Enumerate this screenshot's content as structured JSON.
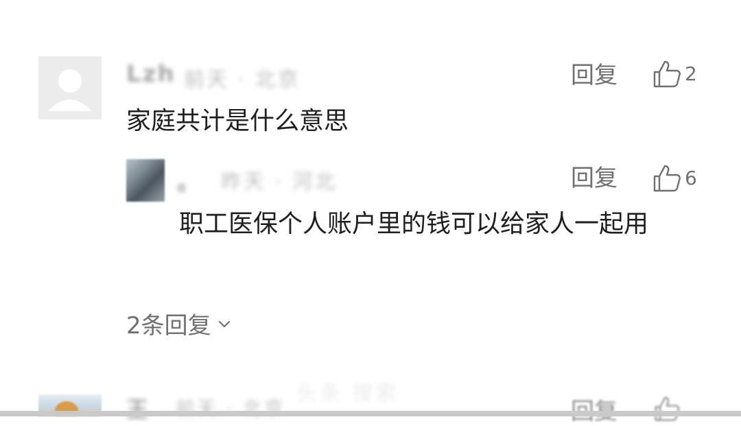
{
  "comments": [
    {
      "username": "Lzh",
      "meta": "前天 · 北京",
      "text": "家庭共计是什么意思",
      "reply_label": "回复",
      "likes": "2",
      "avatar_icon": "default-user-avatar-icon",
      "replies": [
        {
          "username": "。",
          "meta": "昨天 · 河北",
          "text": "职工医保个人账户里的钱可以给家人一起用",
          "reply_label": "回复",
          "likes": "6"
        }
      ],
      "more_replies_label": "2条回复"
    },
    {
      "username": "王",
      "meta": "前天 · 北京",
      "reply_label": "回复"
    }
  ],
  "watermark_text": "头条 搜索",
  "colors": {
    "text_primary": "#1e1e1e",
    "text_secondary": "#6f6f6f",
    "background": "#ffffff"
  },
  "icons": {
    "like": "thumbs-up-icon",
    "expand": "chevron-down-icon"
  }
}
